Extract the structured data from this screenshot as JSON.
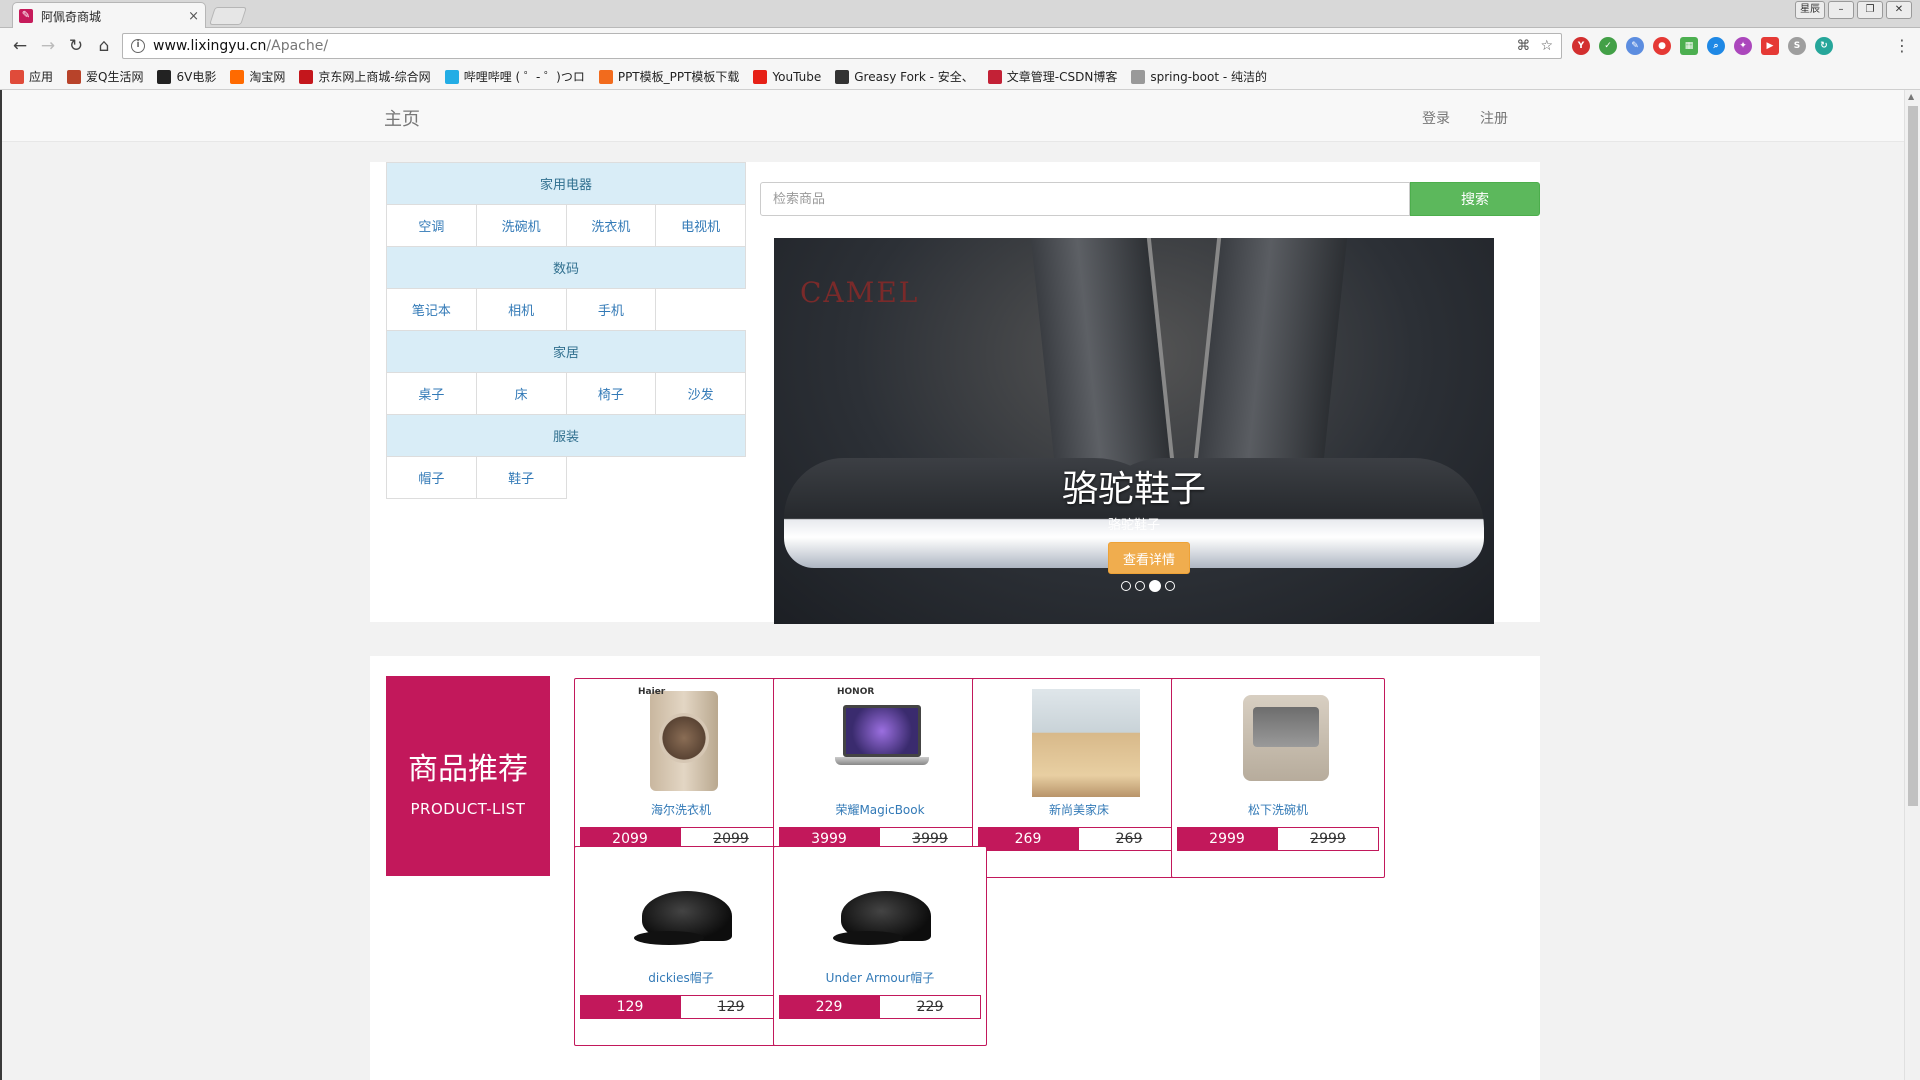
{
  "browser": {
    "tab_title": "阿佩奇商城",
    "tab_close": "×",
    "url_host": "www.lixingyu.cn",
    "url_path": "/Apache/",
    "win_user": "星辰",
    "bookmarks": [
      {
        "label": "应用",
        "color": "#e04b3a",
        "icon": "apps-icon"
      },
      {
        "label": "爱Q生活网",
        "color": "#b8432a",
        "icon": "aiq-icon"
      },
      {
        "label": "6V电影",
        "color": "#222222",
        "icon": "6v-icon"
      },
      {
        "label": "淘宝网",
        "color": "#ff6a00",
        "icon": "taobao-icon"
      },
      {
        "label": "京东网上商城-综合网",
        "color": "#c4161c",
        "icon": "jd-icon"
      },
      {
        "label": "哔哩哔哩 ( ゜- ゜)つロ",
        "color": "#23ade5",
        "icon": "bilibili-icon"
      },
      {
        "label": "PPT模板_PPT模板下载",
        "color": "#f26b1d",
        "icon": "ppt-icon"
      },
      {
        "label": "YouTube",
        "color": "#e62117",
        "icon": "youtube-icon"
      },
      {
        "label": "Greasy Fork - 安全、",
        "color": "#333333",
        "icon": "greasyfork-icon"
      },
      {
        "label": "文章管理-CSDN博客",
        "color": "#c32136",
        "icon": "csdn-icon"
      },
      {
        "label": "spring-boot - 纯洁的",
        "color": "#999999",
        "icon": "spring-icon"
      }
    ]
  },
  "site": {
    "brand": "主页",
    "login": "登录",
    "register": "注册"
  },
  "categories": [
    {
      "name": "家用电器",
      "items": [
        "空调",
        "洗碗机",
        "洗衣机",
        "电视机"
      ]
    },
    {
      "name": "数码",
      "items": [
        "笔记本",
        "相机",
        "手机"
      ]
    },
    {
      "name": "家居",
      "items": [
        "桌子",
        "床",
        "椅子",
        "沙发"
      ]
    },
    {
      "name": "服装",
      "items": [
        "帽子",
        "鞋子"
      ]
    }
  ],
  "search": {
    "placeholder": "检索商品",
    "button": "搜索"
  },
  "carousel": {
    "logo": "CAMEL",
    "title": "骆驼鞋子",
    "subtitle": "骆驼鞋子",
    "button": "查看详情",
    "slide_count": 4,
    "active_index": 2
  },
  "products_section": {
    "title": "商品推荐",
    "subtitle": "PRODUCT-LIST",
    "items": [
      {
        "name": "海尔洗衣机",
        "price": "2099",
        "old_price": "2099",
        "image": "washer",
        "brand_mark": "Haier"
      },
      {
        "name": "荣耀MagicBook",
        "price": "3999",
        "old_price": "3999",
        "image": "laptop",
        "brand_mark": "HONOR"
      },
      {
        "name": "新尚美家床",
        "price": "269",
        "old_price": "269",
        "image": "bed",
        "brand_mark": ""
      },
      {
        "name": "松下洗碗机",
        "price": "2999",
        "old_price": "2999",
        "image": "dishwasher",
        "brand_mark": ""
      },
      {
        "name": "dickies帽子",
        "price": "129",
        "old_price": "129",
        "image": "cap",
        "brand_mark": ""
      },
      {
        "name": "Under Armour帽子",
        "price": "229",
        "old_price": "229",
        "image": "cap",
        "brand_mark": ""
      }
    ]
  },
  "colors": {
    "accent": "#c2185b",
    "search_green": "#5cb85c",
    "cta_orange": "#f0ad4e",
    "category_head": "#d9edf7"
  }
}
